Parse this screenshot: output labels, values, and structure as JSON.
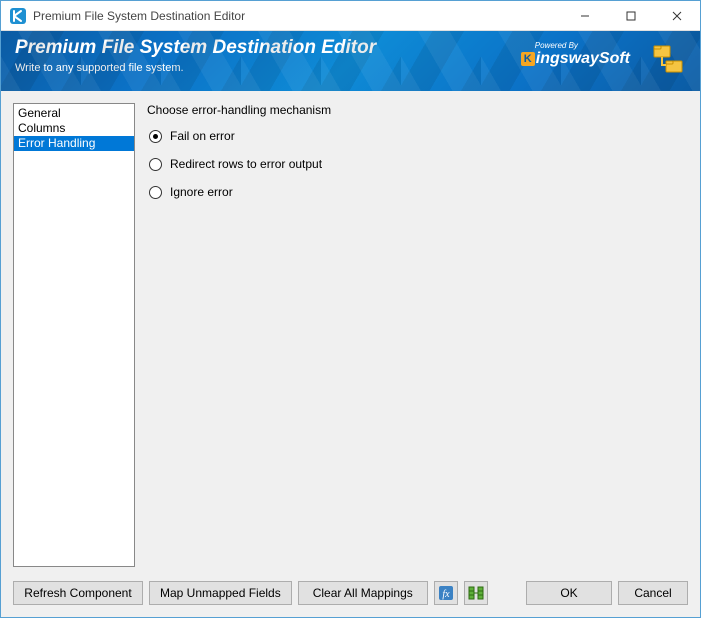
{
  "window": {
    "title": "Premium File System Destination Editor"
  },
  "banner": {
    "heading": "Premium File System Destination Editor",
    "subtitle": "Write to any supported file system.",
    "powered_by": "Powered By",
    "brand": "KingswaySoft"
  },
  "sidebar": {
    "items": [
      {
        "label": "General",
        "selected": false
      },
      {
        "label": "Columns",
        "selected": false
      },
      {
        "label": "Error Handling",
        "selected": true
      }
    ]
  },
  "content": {
    "group_label": "Choose error-handling mechanism",
    "options": [
      {
        "label": "Fail on error",
        "checked": true
      },
      {
        "label": "Redirect rows to error output",
        "checked": false
      },
      {
        "label": "Ignore error",
        "checked": false
      }
    ]
  },
  "footer": {
    "refresh": "Refresh Component",
    "map_unmapped": "Map Unmapped Fields",
    "clear_all": "Clear All Mappings",
    "ok": "OK",
    "cancel": "Cancel"
  }
}
